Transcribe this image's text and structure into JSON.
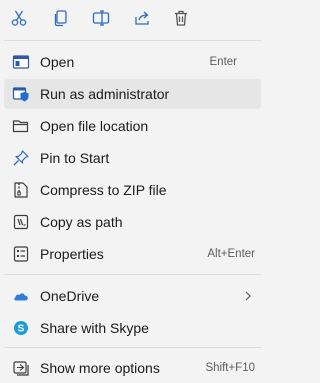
{
  "toolbar": {
    "icons": [
      "cut-icon",
      "copy-icon",
      "rename-icon",
      "share-icon",
      "delete-icon"
    ]
  },
  "menu": {
    "open": {
      "label": "Open",
      "shortcut": "Enter"
    },
    "run_as_admin": {
      "label": "Run as administrator"
    },
    "open_file_location": {
      "label": "Open file location"
    },
    "pin_to_start": {
      "label": "Pin to Start"
    },
    "compress_zip": {
      "label": "Compress to ZIP file"
    },
    "copy_as_path": {
      "label": "Copy as path"
    },
    "properties": {
      "label": "Properties",
      "shortcut": "Alt+Enter"
    },
    "onedrive": {
      "label": "OneDrive"
    },
    "share_skype": {
      "label": "Share with Skype"
    },
    "show_more": {
      "label": "Show more options",
      "shortcut": "Shift+F10"
    }
  },
  "colors": {
    "accent": "#1f6fd1",
    "onedrive": "#2f7fd8",
    "skype": "#1e9ad6"
  }
}
